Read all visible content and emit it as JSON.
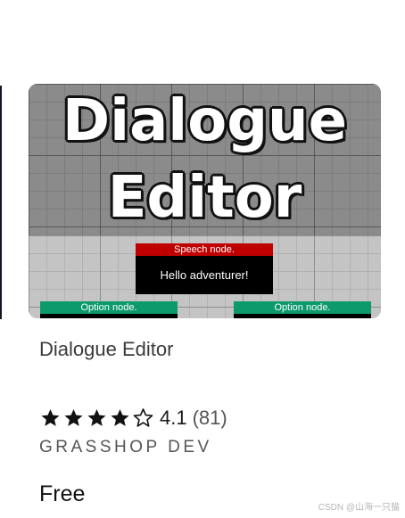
{
  "card": {
    "image": {
      "hero_line1": "Dialogue",
      "hero_line2": "Editor",
      "speech_node": {
        "header": "Speech node.",
        "body": "Hello adventurer!"
      },
      "option_nodes": [
        {
          "header": "Option node."
        },
        {
          "header": "Option node."
        }
      ]
    },
    "title": "Dialogue Editor",
    "rating": {
      "value": "4.1",
      "count": "(81)",
      "stars_filled": 4,
      "stars_total": 5
    },
    "publisher": "GRASSHOP DEV",
    "price": "Free"
  },
  "watermark": "CSDN @山海一只猫",
  "colors": {
    "speech_header": "#c00000",
    "option_header": "#0c9a6c",
    "node_body": "#000000",
    "grid_dark": "#8b8b8b",
    "grid_light": "#c4c4c4"
  },
  "icons": {
    "filled_star": "star-filled-icon",
    "empty_star": "star-outline-icon"
  }
}
